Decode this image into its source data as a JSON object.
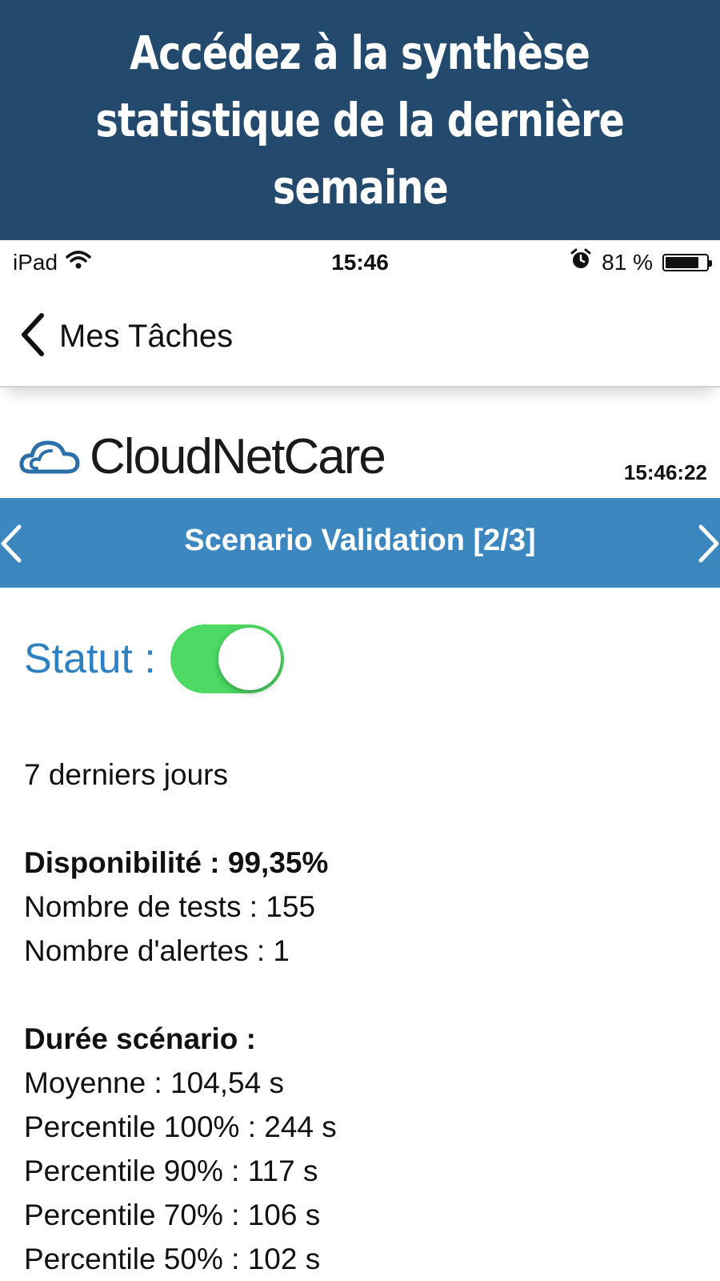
{
  "banner": {
    "line1": "Accédez à la synthèse",
    "line2": "statistique de la dernière",
    "line3": "semaine"
  },
  "status_bar": {
    "device": "iPad",
    "time": "15:46",
    "battery_text": "81 %",
    "battery_level": 0.81
  },
  "nav": {
    "back_label": "Mes Tâches"
  },
  "logo": {
    "text": "CloudNetCare"
  },
  "clock": "15:46:22",
  "scenario": {
    "title": "Scenario Validation [2/3]"
  },
  "statut": {
    "label": "Statut :",
    "enabled": true
  },
  "stats": {
    "period": "7 derniers jours",
    "availability": "Disponibilité : 99,35%",
    "tests": "Nombre de tests : 155",
    "alerts": "Nombre d'alertes : 1",
    "duration_header": "Durée scénario :",
    "average": "Moyenne : 104,54 s",
    "p100": "Percentile 100% : 244 s",
    "p90": "Percentile 90% : 117 s",
    "p70": "Percentile 70% : 106 s",
    "p50": "Percentile 50% : 102 s"
  },
  "colors": {
    "banner_bg": "#234a6c",
    "scenario_bar": "#3c87c0",
    "statut_label": "#2e80bf",
    "toggle_on": "#4cd964"
  }
}
